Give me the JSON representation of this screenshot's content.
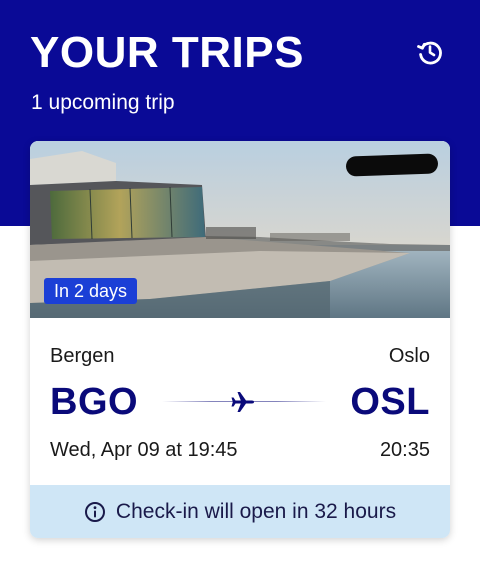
{
  "header": {
    "title": "YOUR TRIPS",
    "subtitle": "1 upcoming trip",
    "history_icon": "history-icon",
    "background_color": "#0a0a96"
  },
  "trip": {
    "image_icon": "oslo-opera-house-photo",
    "badge": "In 2 days",
    "badge_color": "#1b3fd6",
    "origin": {
      "city": "Bergen",
      "code": "BGO",
      "time": "Wed, Apr 09 at 19:45"
    },
    "destination": {
      "city": "Oslo",
      "code": "OSL",
      "time": "20:35"
    },
    "route_icon": "airplane-icon",
    "checkin": {
      "icon": "info-icon",
      "text": "Check-in will open in 32 hours",
      "background_color": "#cfe6f6"
    }
  }
}
